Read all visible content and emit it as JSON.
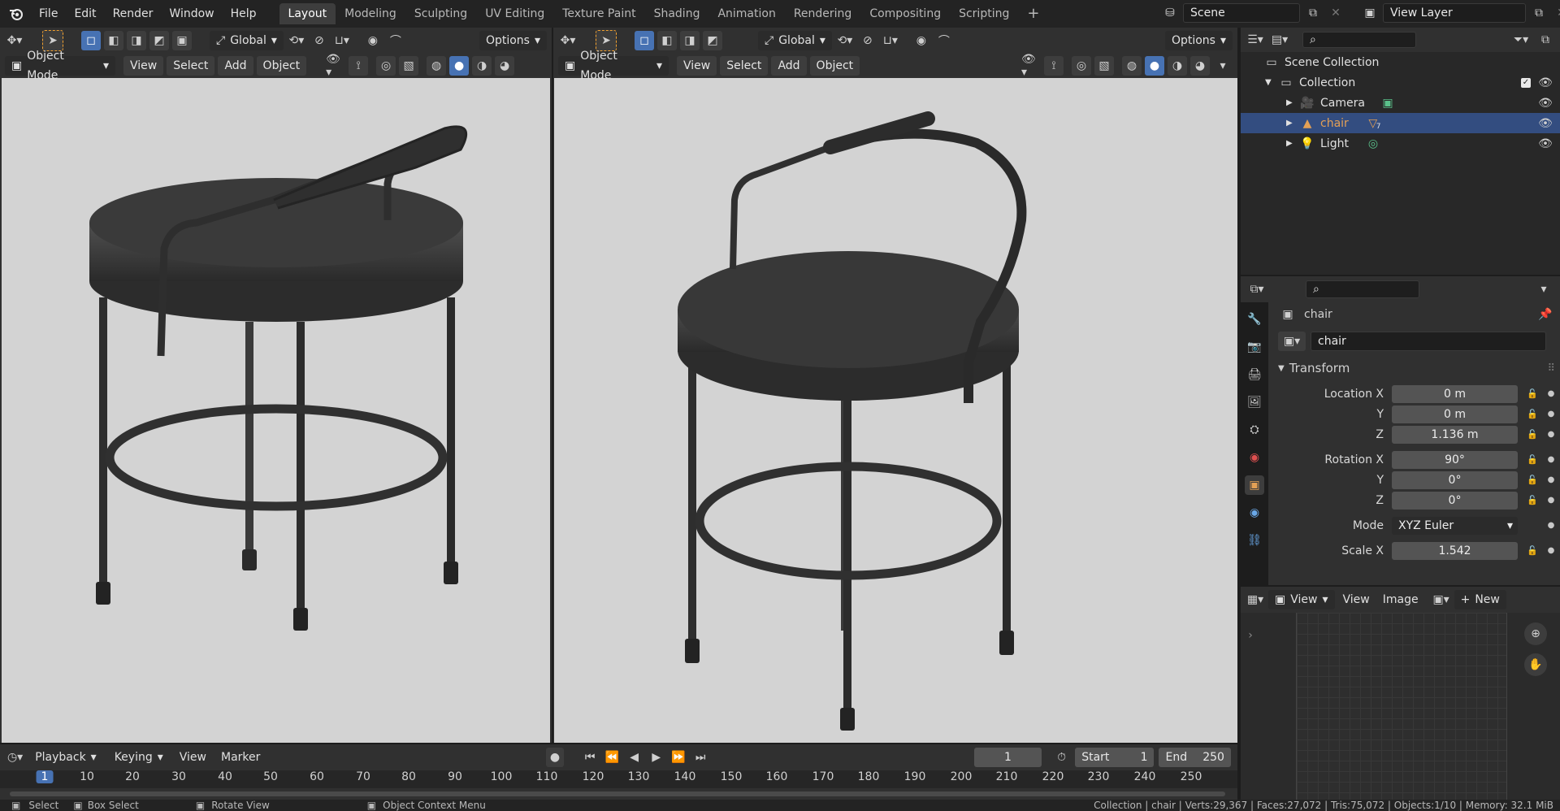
{
  "menus": [
    "File",
    "Edit",
    "Render",
    "Window",
    "Help"
  ],
  "workspaces": [
    "Layout",
    "Modeling",
    "Sculpting",
    "UV Editing",
    "Texture Paint",
    "Shading",
    "Animation",
    "Rendering",
    "Compositing",
    "Scripting"
  ],
  "add_workspace": "+",
  "scene": {
    "label": "Scene"
  },
  "view_layer": {
    "label": "View Layer"
  },
  "viewport_left": {
    "transform": "Global",
    "options": "Options",
    "mode": "Object Mode",
    "menus": [
      "View",
      "Select",
      "Add",
      "Object"
    ]
  },
  "viewport_right": {
    "transform": "Global",
    "options": "Options",
    "mode": "Object Mode",
    "menus": [
      "View",
      "Select",
      "Add",
      "Object"
    ]
  },
  "outliner": {
    "root": "Scene Collection",
    "collection": "Collection",
    "items": [
      {
        "name": "Camera",
        "color": "#e0e0e0"
      },
      {
        "name": "chair",
        "color": "#e3a055"
      },
      {
        "name": "Light",
        "color": "#e0e0e0"
      }
    ],
    "chair_badge": "7"
  },
  "properties": {
    "object_title": "chair",
    "object_name": "chair",
    "section": "Transform",
    "location": {
      "label": "Location X",
      "x": "0 m",
      "y": "0 m",
      "z": "1.136 m"
    },
    "rotation": {
      "label": "Rotation X",
      "x": "90°",
      "y": "0°",
      "z": "0°"
    },
    "axis_y": "Y",
    "axis_z": "Z",
    "mode_label": "Mode",
    "mode_value": "XYZ Euler",
    "scale": {
      "label": "Scale X",
      "x": "1.542"
    }
  },
  "image_editor": {
    "view1": "View",
    "view2": "View",
    "image": "Image",
    "new": "New"
  },
  "timeline": {
    "playback": "Playback",
    "keying": "Keying",
    "view": "View",
    "marker": "Marker",
    "current_frame": "1",
    "start_label": "Start",
    "start": "1",
    "end_label": "End",
    "end": "250",
    "ticks": [
      "1",
      "10",
      "20",
      "30",
      "40",
      "50",
      "60",
      "70",
      "80",
      "90",
      "100",
      "110",
      "120",
      "130",
      "140",
      "150",
      "160",
      "170",
      "180",
      "190",
      "200",
      "210",
      "220",
      "230",
      "240",
      "250"
    ]
  },
  "statusbar": {
    "select": "Select",
    "box_select": "Box Select",
    "rotate_view": "Rotate View",
    "context_menu": "Object Context Menu",
    "stats": "Collection | chair | Verts:29,367 | Faces:27,072 | Tris:75,072 | Objects:1/10 | Memory: 32.1 MiB"
  },
  "colors": {
    "accent": "#4772b3",
    "selected_row": "#334d80",
    "chair_orange": "#e3a055",
    "viewport_bg": "#d3d3d3"
  }
}
